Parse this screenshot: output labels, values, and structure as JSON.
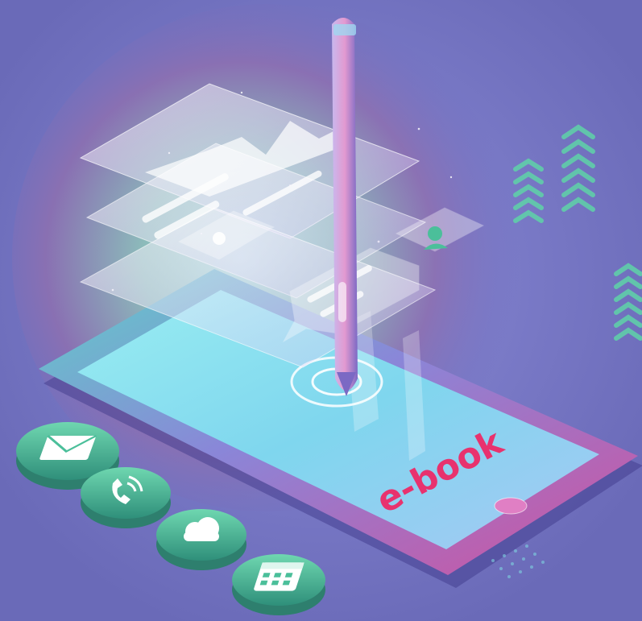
{
  "illustration": {
    "ebook_label": "e-book",
    "icons": [
      "mail-icon",
      "phone-icon",
      "cloud-icon",
      "calendar-icon"
    ],
    "colors": {
      "background": "#6f6fc0",
      "tablet_frame": "#c25bb5",
      "tablet_screen": "#7fdcec",
      "label": "#e8326e",
      "icon_badge": "#4bbf9a",
      "chevrons": "#5fd3a8"
    }
  }
}
